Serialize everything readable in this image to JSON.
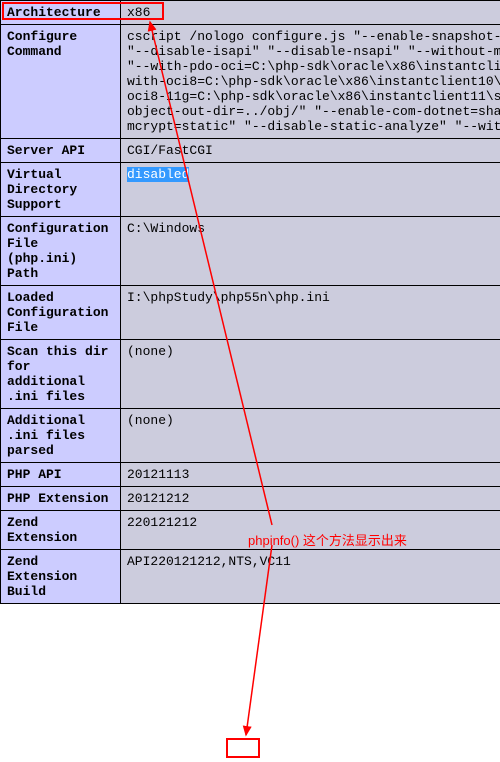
{
  "rows": [
    {
      "label": "Architecture",
      "value": "x86"
    },
    {
      "label": "Configure Command",
      "value": "cscript /nologo configure.js \"--enable-snapshot-build\" \"--disable-zts\" \"--disable-isapi\" \"--disable-nsapi\" \"--without-mssql\" \"--without-pi3web\" \"--with-pdo-oci=C:\\php-sdk\\oracle\\x86\\instantclient10\\sdk,shared\" \"--with-oci8=C:\\php-sdk\\oracle\\x86\\instantclient10\\sdk,shared\" \"--with-oci8-11g=C:\\php-sdk\\oracle\\x86\\instantclient11\\sdk,shared\" \"--enable-object-out-dir=../obj/\" \"--enable-com-dotnet=shared\" \"--with-mcrypt=static\" \"--disable-static-analyze\" \"--with-pgo\""
    },
    {
      "label": "Server API",
      "value": "CGI/FastCGI"
    },
    {
      "label": "Virtual Directory Support",
      "value": "disabled",
      "selected": true
    },
    {
      "label": "Configuration File (php.ini) Path",
      "value": "C:\\Windows"
    },
    {
      "label": "Loaded Configuration File",
      "value": "I:\\phpStudy\\php55n\\php.ini"
    },
    {
      "label": "Scan this dir for additional .ini files",
      "value": "(none)"
    },
    {
      "label": "Additional .ini files parsed",
      "value": "(none)"
    },
    {
      "label": "PHP API",
      "value": "20121113"
    },
    {
      "label": "PHP Extension",
      "value": "20121212"
    },
    {
      "label": "Zend Extension",
      "value": "220121212"
    },
    {
      "label": "Zend Extension Build",
      "value": "API220121212,NTS,VC11"
    }
  ],
  "annotation": "phpinfo() 这个方法显示出来",
  "highlight_nts": "NTS"
}
